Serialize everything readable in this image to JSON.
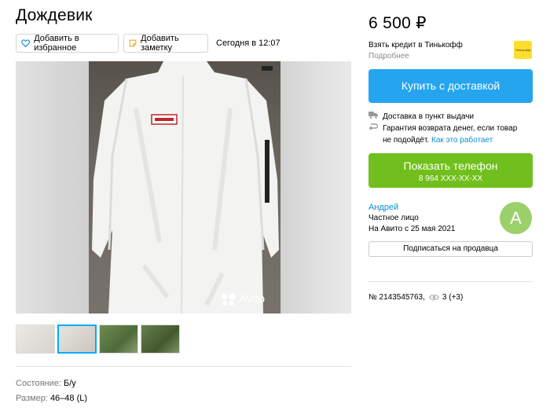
{
  "listing": {
    "title": "Дождевик",
    "actions": {
      "favorite_label": "Добавить в избранное",
      "note_label": "Добавить заметку"
    },
    "date": "Сегодня в 12:07",
    "watermark": "Avito",
    "thumbnails": [
      {
        "name": "thumb-1"
      },
      {
        "name": "thumb-2",
        "active": true
      },
      {
        "name": "thumb-3"
      },
      {
        "name": "thumb-4"
      }
    ],
    "params": [
      {
        "key": "Состояние:",
        "value": "Б/у"
      },
      {
        "key": "Размер:",
        "value": "46–48 (L)"
      }
    ]
  },
  "sidebar": {
    "price": "6 500 ₽",
    "credit": {
      "title": "Взять кредит в Тинькофф",
      "more": "Подробнее",
      "logo_text": "Тинькофф"
    },
    "buy_button": "Купить с доставкой",
    "delivery": "Доставка в пункт выдачи",
    "guarantee_text": "Гарантия возврата денег, если товар не подойдёт.",
    "guarantee_link": "Как это работает",
    "phone_button": {
      "label": "Показать телефон",
      "number": "8 964 XXX-XX-XX"
    },
    "seller": {
      "name": "Андрей",
      "type": "Частное лицо",
      "since": "На Авито с 25 мая 2021",
      "avatar_letter": "А",
      "subscribe_label": "Подписаться на продавца"
    },
    "item_number": "№ 2143545763,",
    "views": "3 (+3)"
  },
  "colors": {
    "buy": "#25a5f0",
    "phone": "#71bf1d",
    "link": "#0a8fd6",
    "avatar": "#9bd06b"
  },
  "icons": [
    "heart-icon",
    "note-icon",
    "truck-icon",
    "return-icon",
    "eye-icon",
    "avito-logo-icon"
  ]
}
